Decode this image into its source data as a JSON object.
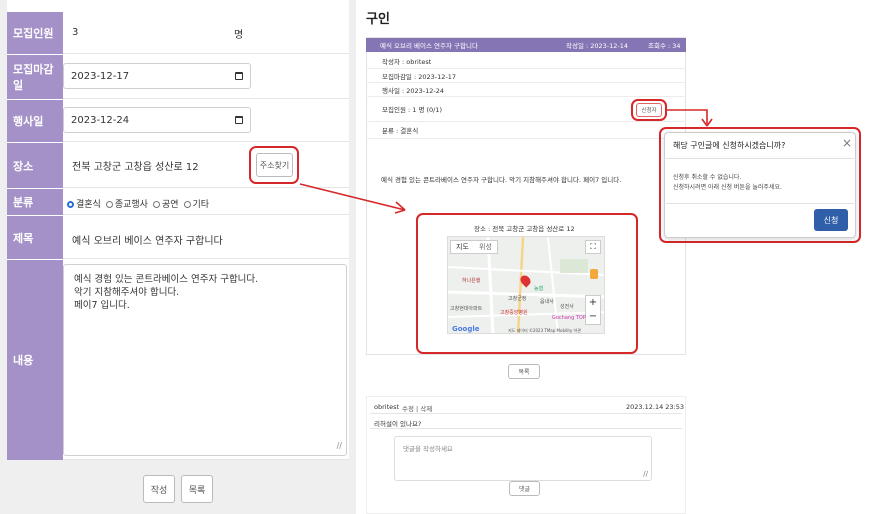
{
  "form": {
    "rows": [
      {
        "label": "모집인원",
        "value": "3",
        "unit": "명"
      },
      {
        "label": "모집마감일",
        "value": "2023-12-17"
      },
      {
        "label": "행사일",
        "value": "2023-12-24"
      },
      {
        "label": "장소",
        "value": "전북 고창군 고창읍 성산로 12",
        "button": "주소찾기"
      },
      {
        "label": "분류",
        "options": [
          "결혼식",
          "종교행사",
          "공연",
          "기타"
        ]
      },
      {
        "label": "제목",
        "value": "예식 오브리 베이스 연주자 구합니다"
      },
      {
        "label": "내용",
        "lines": [
          "예식 경험 있는 콘트라베이스 연주자 구합니다.",
          "악기 지참해주셔야 합니다.",
          "페이7 입니다."
        ]
      }
    ],
    "submit_label": "작성",
    "list_label": "목록"
  },
  "right": {
    "section_title": "구인",
    "post": {
      "title": "예식 오브리 베이스 연주자 구합니다",
      "date": "작성일 : 2023-12-14",
      "views": "조회수 : 34",
      "author": "작성자 : obritest",
      "deadline": "모집마감일 : 2023-12-17",
      "event_date": "행사일 : 2023-12-24",
      "recruit": "모집인원 : 1 명 (0/1)",
      "apply_label": "신청자",
      "category": "분류 : 결혼식",
      "body": "예식 경험 있는 콘트라베이스 연주자 구합니다. 악기 지참해주셔야 합니다. 페이7 입니다.",
      "place": "장소 : 전북 고창군 고창읍 성산로 12"
    },
    "map": {
      "tab_map": "지도",
      "tab_sat": "위성",
      "labels": [
        "하나은행",
        "농협",
        "고창군청",
        "고창현대아파트",
        "고창중앙병원",
        "성전사",
        "읍내사",
        "Gochang TOP"
      ],
      "attribution": "지도 데이터 ©2023 TMap Mobility 약관",
      "google": "Google"
    },
    "list_label": "목록",
    "comment": {
      "author": "obritest",
      "actions": "수정 | 삭제",
      "time": "2023.12.14 23:53",
      "text": "리허설이 있나요?"
    },
    "comment_placeholder": "댓글을 작성하세요",
    "comment_button": "댓글"
  },
  "modal": {
    "title": "해당 구인글에 신청하시겠습니까?",
    "line1": "신청후 취소할 수 없습니다.",
    "line2": "신청하시려면 아래 신청 버튼을 눌러주세요.",
    "confirm": "신청",
    "close": "×"
  },
  "colors": {
    "label_bg": "#a491c8",
    "header_bg": "#8575b5",
    "highlight": "#d62828",
    "modal_btn": "#2f5fa8"
  }
}
